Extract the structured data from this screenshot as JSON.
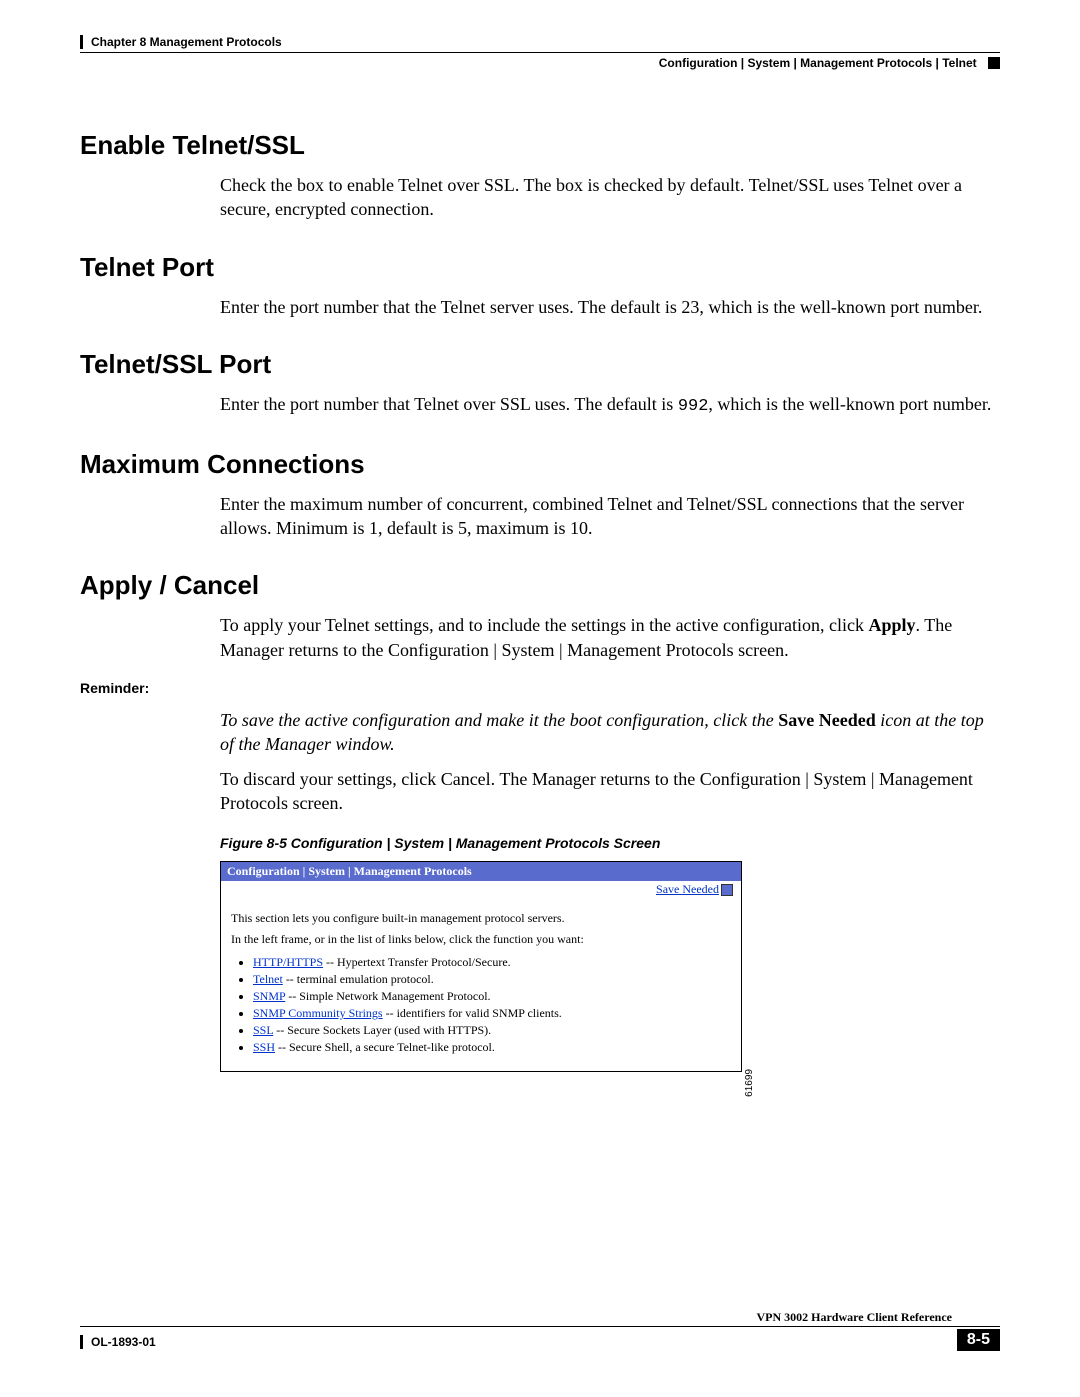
{
  "header": {
    "chapter": "Chapter 8      Management Protocols",
    "breadcrumb": "Configuration | System | Management Protocols | Telnet"
  },
  "sections": {
    "s1": {
      "title": "Enable Telnet/SSL",
      "body": "Check the box to enable Telnet over SSL. The box is checked by default. Telnet/SSL uses Telnet over a secure, encrypted connection."
    },
    "s2": {
      "title": "Telnet Port",
      "body": "Enter the port number that the Telnet server uses. The default is 23, which is the well-known port number."
    },
    "s3": {
      "title": "Telnet/SSL Port",
      "body_pre": "Enter the port number that Telnet over SSL uses. The default is ",
      "body_code": "992",
      "body_post": ", which is the well-known port number."
    },
    "s4": {
      "title": "Maximum Connections",
      "body": "Enter the maximum number of concurrent, combined Telnet and Telnet/SSL connections that the server allows. Minimum is 1, default is 5, maximum is 10."
    },
    "s5": {
      "title": "Apply / Cancel",
      "body_pre": "To apply your Telnet settings, and to include the settings in the active configuration, click ",
      "body_bold": "Apply",
      "body_post": ". The Manager returns to the Configuration | System | Management Protocols screen."
    }
  },
  "reminder": {
    "label": "Reminder:",
    "italic_pre": "To save the active configuration and make it the boot configuration, click the ",
    "bold": "Save Needed",
    "italic_post": " icon at the top of the Manager window.",
    "followup": "To discard your settings, click Cancel. The Manager returns to the Configuration | System | Management Protocols screen."
  },
  "figure": {
    "caption": "Figure 8-5    Configuration | System | Management Protocols Screen",
    "header": "Configuration | System | Management Protocols",
    "save": "Save Needed",
    "p1": "This section lets you configure built-in management protocol servers.",
    "p2": "In the left frame, or in the list of links below, click the function you want:",
    "links": {
      "l1a": "HTTP/HTTPS",
      "l1b": " -- Hypertext Transfer Protocol/Secure.",
      "l2a": "Telnet",
      "l2b": " -- terminal emulation protocol.",
      "l3a": "SNMP",
      "l3b": " -- Simple Network Management Protocol.",
      "l4a": "SNMP Community Strings",
      "l4b": " -- identifiers for valid SNMP clients.",
      "l5a": "SSL",
      "l5b": " -- Secure Sockets Layer (used with HTTPS).",
      "l6a": "SSH",
      "l6b": " -- Secure Shell, a secure Telnet-like protocol."
    },
    "code": "61699"
  },
  "footer": {
    "doc": "OL-1893-01",
    "title": "VPN 3002 Hardware Client Reference",
    "page": "8-5"
  }
}
